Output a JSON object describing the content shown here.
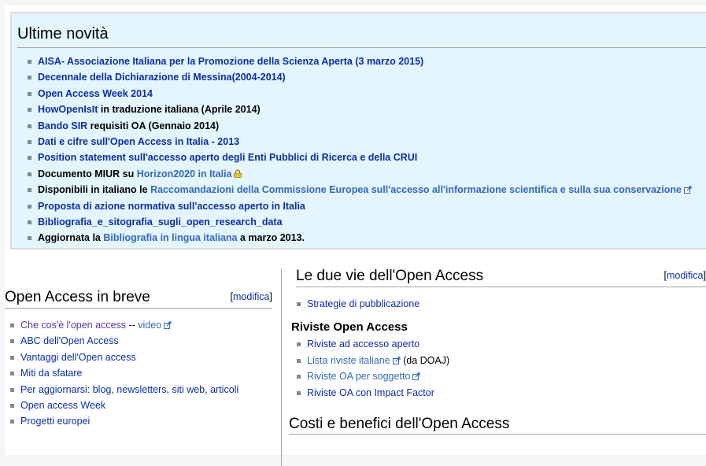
{
  "news": {
    "title": "Ultime novità",
    "items": [
      {
        "parts": [
          {
            "t": "AISA- Associazione Italiana per la Promozione della Scienza Aperta (3 marzo 2015)",
            "k": "dark"
          }
        ]
      },
      {
        "parts": [
          {
            "t": "Decennale della Dichiarazione di Messina(2004-2014)",
            "k": "dark"
          }
        ]
      },
      {
        "parts": [
          {
            "t": "Open Access Week 2014",
            "k": "dark"
          }
        ]
      },
      {
        "parts": [
          {
            "t": "HowOpenIsIt",
            "k": "dark"
          },
          {
            "t": " in traduzione italiana (Aprile 2014)",
            "k": "text"
          }
        ]
      },
      {
        "parts": [
          {
            "t": "Bando SIR",
            "k": "dark"
          },
          {
            "t": " requisiti OA (Gennaio 2014)",
            "k": "text"
          }
        ]
      },
      {
        "parts": [
          {
            "t": "Dati e cifre sull'Open Access in Italia - 2013",
            "k": "dark"
          }
        ]
      },
      {
        "parts": [
          {
            "t": "Position statement sull'accesso aperto degli Enti Pubblici di Ricerca e della CRUI",
            "k": "dark"
          }
        ]
      },
      {
        "parts": [
          {
            "t": "Documento MIUR su ",
            "k": "text"
          },
          {
            "t": "Horizon2020 in Italia",
            "k": "light",
            "icon": "lock"
          }
        ]
      },
      {
        "parts": [
          {
            "t": "Disponibili in italiano le ",
            "k": "text"
          },
          {
            "t": "Raccomandazioni della Commissione Europea sull'accesso all'informazione scientifica e sulla sua conservazione",
            "k": "light",
            "icon": "external"
          }
        ]
      },
      {
        "parts": [
          {
            "t": "Proposta di azione normativa sull'accesso aperto in Italia",
            "k": "dark"
          }
        ]
      },
      {
        "parts": [
          {
            "t": "Bibliografia_e_sitografia_sugli_open_research_data",
            "k": "dark"
          }
        ]
      },
      {
        "parts": [
          {
            "t": "Aggiornata la ",
            "k": "text"
          },
          {
            "t": "Bibliografia in lingua italiana",
            "k": "light"
          },
          {
            "t": " a marzo 2013.",
            "k": "text"
          }
        ]
      }
    ]
  },
  "left": {
    "title": "Open Access in breve",
    "edit_open": "[",
    "edit_label": "modifica",
    "edit_close": "]",
    "items": [
      {
        "parts": [
          {
            "t": "Che cos'è l'open access",
            "k": "visited"
          },
          {
            "t": " -- ",
            "k": "text"
          },
          {
            "t": "video",
            "k": "light",
            "icon": "external"
          }
        ]
      },
      {
        "parts": [
          {
            "t": "ABC dell'Open Access",
            "k": "dark"
          }
        ]
      },
      {
        "parts": [
          {
            "t": "Vantaggi dell'Open access",
            "k": "dark"
          }
        ]
      },
      {
        "parts": [
          {
            "t": "Miti da sfatare",
            "k": "dark"
          }
        ]
      },
      {
        "parts": [
          {
            "t": "Per aggiornarsi: blog, newsletters, siti web, articoli",
            "k": "dark"
          }
        ]
      },
      {
        "parts": [
          {
            "t": "Open access Week",
            "k": "dark"
          }
        ]
      },
      {
        "parts": [
          {
            "t": "Progetti europei",
            "k": "dark"
          }
        ]
      }
    ]
  },
  "right": {
    "title": "Le due vie dell'Open Access",
    "edit_open": "[",
    "edit_label": "modifica",
    "edit_close": "]",
    "items": [
      {
        "parts": [
          {
            "t": "Strategie di pubblicazione",
            "k": "dark"
          }
        ]
      }
    ],
    "sub_title": "Riviste Open Access",
    "sub_items": [
      {
        "parts": [
          {
            "t": "Riviste ad accesso aperto",
            "k": "dark"
          }
        ]
      },
      {
        "parts": [
          {
            "t": "Lista riviste italiane",
            "k": "light",
            "icon": "external"
          },
          {
            "t": " (da DOAJ)",
            "k": "text"
          }
        ]
      },
      {
        "parts": [
          {
            "t": "Riviste OA per soggetto",
            "k": "light",
            "icon": "external"
          }
        ]
      },
      {
        "parts": [
          {
            "t": "Riviste OA con Impact Factor",
            "k": "dark"
          }
        ]
      }
    ],
    "next_title": "Costi e benefici dell'Open Access"
  }
}
